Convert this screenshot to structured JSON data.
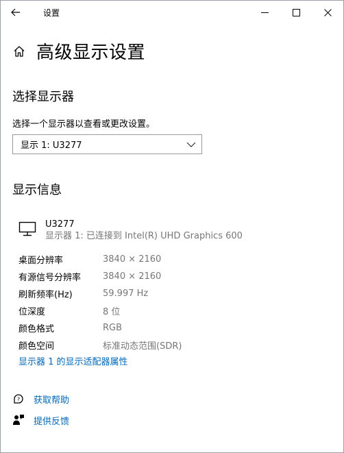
{
  "window": {
    "title": "设置"
  },
  "header": {
    "title": "高级显示设置"
  },
  "select_display": {
    "title": "选择显示器",
    "description": "选择一个显示器以查看或更改设置。",
    "selected": "显示 1: U3277"
  },
  "display_info": {
    "title": "显示信息",
    "monitor_name": "U3277",
    "monitor_connection": "显示器 1: 已连接到 Intel(R) UHD Graphics 600",
    "rows": [
      {
        "label": "桌面分辨率",
        "value": "3840 × 2160"
      },
      {
        "label": "有源信号分辨率",
        "value": "3840 × 2160"
      },
      {
        "label": "刷新频率(Hz)",
        "value": "59.997 Hz"
      },
      {
        "label": "位深度",
        "value": "8 位"
      },
      {
        "label": "颜色格式",
        "value": "RGB"
      },
      {
        "label": "颜色空间",
        "value": "标准动态范围(SDR)"
      }
    ],
    "adapter_link": "显示器 1 的显示适配器属性"
  },
  "help": {
    "get_help": "获取帮助",
    "feedback": "提供反馈"
  },
  "icons": {
    "back": "back-arrow-icon",
    "minimize": "minimize-icon",
    "maximize": "maximize-icon",
    "close": "close-icon",
    "home": "home-icon",
    "monitor": "monitor-icon",
    "chevron": "chevron-down-icon",
    "help": "help-chat-icon",
    "feedback": "feedback-person-icon"
  },
  "colors": {
    "link": "#0067b8",
    "secondary_text": "#767676",
    "border": "#999999"
  }
}
